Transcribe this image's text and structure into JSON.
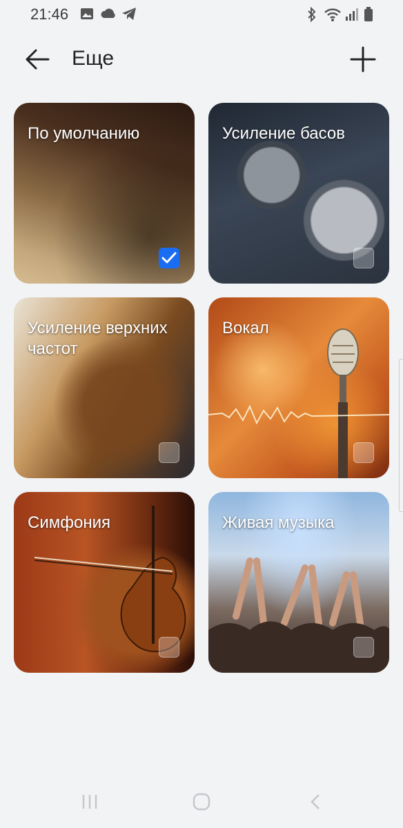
{
  "status_bar": {
    "time": "21:46",
    "left_icons": [
      "gallery-icon",
      "cloud-icon",
      "telegram-icon"
    ],
    "right_icons": [
      "bluetooth-icon",
      "wifi-icon",
      "signal-icon",
      "battery-icon"
    ]
  },
  "header": {
    "title": "Еще",
    "back_icon": "arrow-left-icon",
    "add_icon": "plus-icon"
  },
  "presets": [
    {
      "label": "По умолчанию",
      "selected": true
    },
    {
      "label": "Усиление басов",
      "selected": false
    },
    {
      "label": "Усиление верхних частот",
      "selected": false
    },
    {
      "label": "Вокал",
      "selected": false
    },
    {
      "label": "Симфония",
      "selected": false
    },
    {
      "label": "Живая музыка",
      "selected": false
    }
  ],
  "nav_bar": {
    "icons": [
      "recent-apps-icon",
      "home-icon",
      "back-icon"
    ]
  },
  "colors": {
    "accent": "#1a6cf2",
    "background": "#f2f3f5"
  }
}
